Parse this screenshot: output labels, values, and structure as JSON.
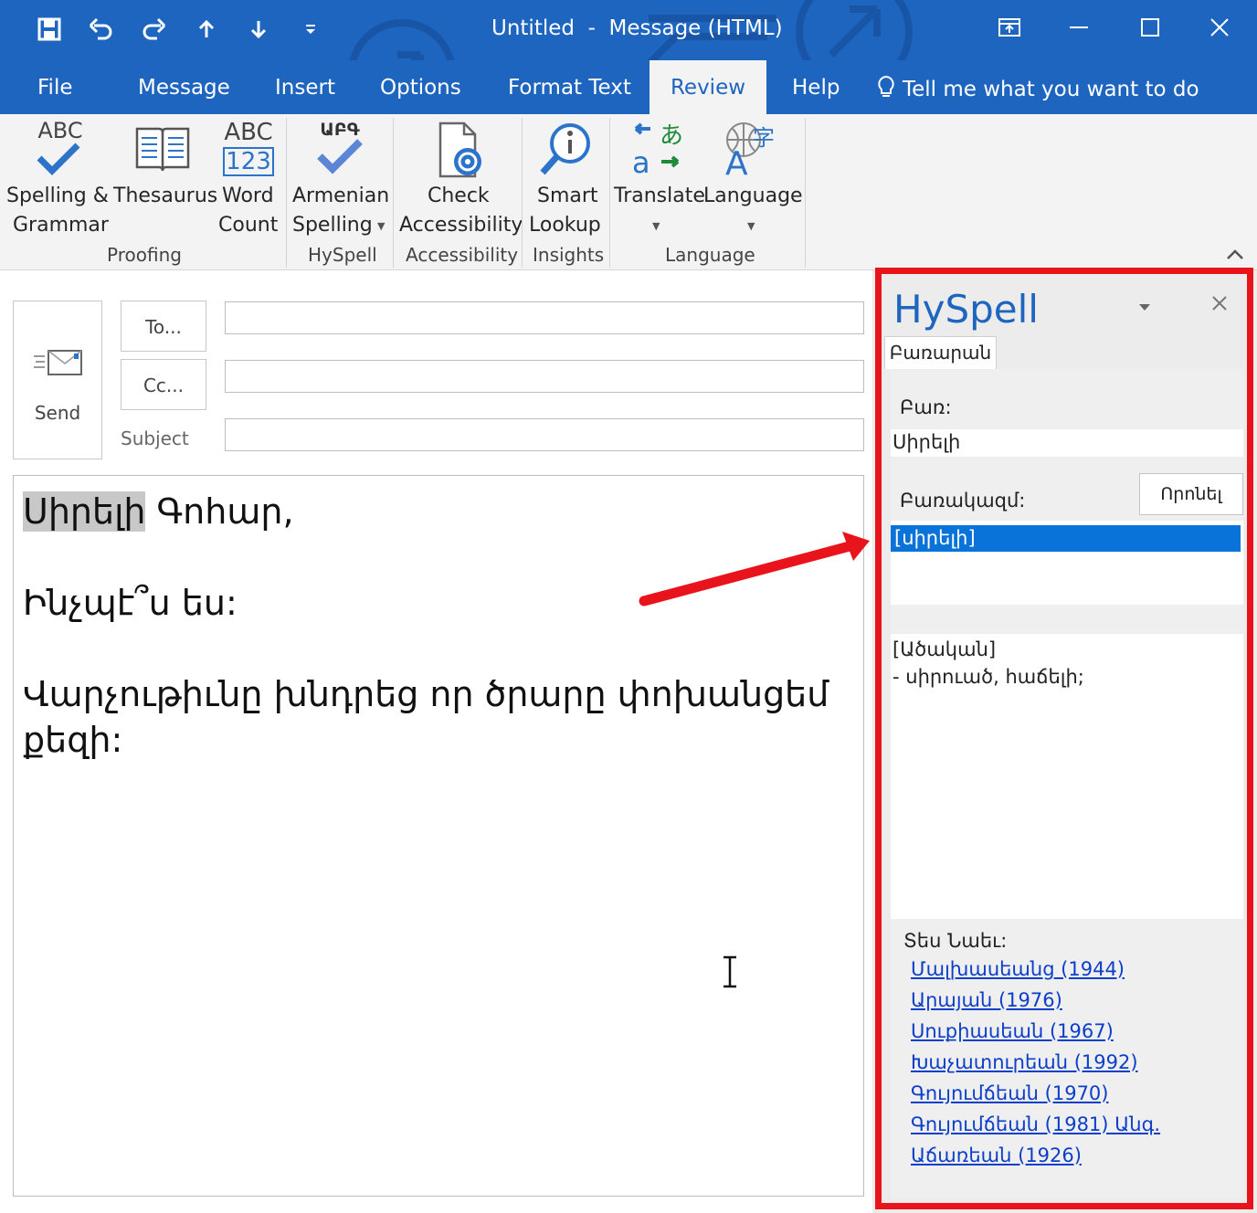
{
  "window": {
    "title": "Untitled  -  Message (HTML)",
    "quick_access": [
      "save-icon",
      "undo-icon",
      "redo-icon",
      "up-icon",
      "down-icon",
      "customize-icon"
    ],
    "controls": [
      "restore-ribbon-icon",
      "minimize-icon",
      "maximize-icon",
      "close-icon"
    ]
  },
  "tabs": [
    {
      "label": "File"
    },
    {
      "label": "Message"
    },
    {
      "label": "Insert"
    },
    {
      "label": "Options"
    },
    {
      "label": "Format Text"
    },
    {
      "label": "Review",
      "active": true
    },
    {
      "label": "Help"
    }
  ],
  "tell_me": "Tell me what you want to do",
  "ribbon": {
    "buttons": {
      "spelling": {
        "line1": "Spelling &",
        "line2": "Grammar",
        "icon": "spelling-icon",
        "icon_text": "ABC"
      },
      "thesaurus": {
        "line1": "Thesaurus",
        "icon": "thesaurus-icon"
      },
      "wordcount": {
        "line1": "Word",
        "line2": "Count",
        "icon": "word-count-icon",
        "icon_text1": "ABC",
        "icon_text2": "123"
      },
      "armenian": {
        "line1": "Armenian",
        "line2": "Spelling",
        "icon": "armenian-spelling-icon",
        "icon_text": "ԱԲԳ"
      },
      "accessibility": {
        "line1": "Check",
        "line2": "Accessibility",
        "icon": "accessibility-icon"
      },
      "smartlookup": {
        "line1": "Smart",
        "line2": "Lookup",
        "icon": "smart-lookup-icon"
      },
      "translate": {
        "line1": "Translate",
        "icon": "translate-icon"
      },
      "language": {
        "line1": "Language",
        "icon": "language-icon"
      }
    },
    "groups": {
      "proofing": "Proofing",
      "hyspell": "HySpell",
      "accessibility": "Accessibility",
      "insights": "Insights",
      "language": "Language"
    }
  },
  "compose": {
    "send": "Send",
    "to": "To...",
    "cc": "Cc...",
    "subject": "Subject",
    "body": {
      "highlight": "Սիրելի",
      "line1_rest": " Գոհար,",
      "line2": "Ինչպէ՞ս ես:",
      "line3": "Վարչութիւնը խնդրեց որ ծրարը փոխանցեմ քեզի:"
    }
  },
  "pane": {
    "title": "HySpell",
    "tab": "Բառարան",
    "word_label": "Բառ:",
    "word_value": "Սիրելի",
    "find_button": "Որոնել",
    "phrase_label": "Բառակազմ:",
    "selected_item": "[սիրելի]",
    "definition": "[Ածական]\n- սիրուած, հաճելի;",
    "see_also_label": "Տես Նաեւ:",
    "see_also": [
      "Մալխասեանց (1944)",
      "Արայան (1976)",
      "Սուքիասեան (1967)",
      "Խաչատուրեան (1992)",
      "Գույումճեան (1970)",
      "Գույումճեան (1981) Անգ.",
      "Աճառեան (1926)"
    ]
  },
  "colors": {
    "brand": "#1e65bf",
    "annotation": "#e8131b",
    "selection": "#0a73d9",
    "link": "#0b3ec9"
  }
}
